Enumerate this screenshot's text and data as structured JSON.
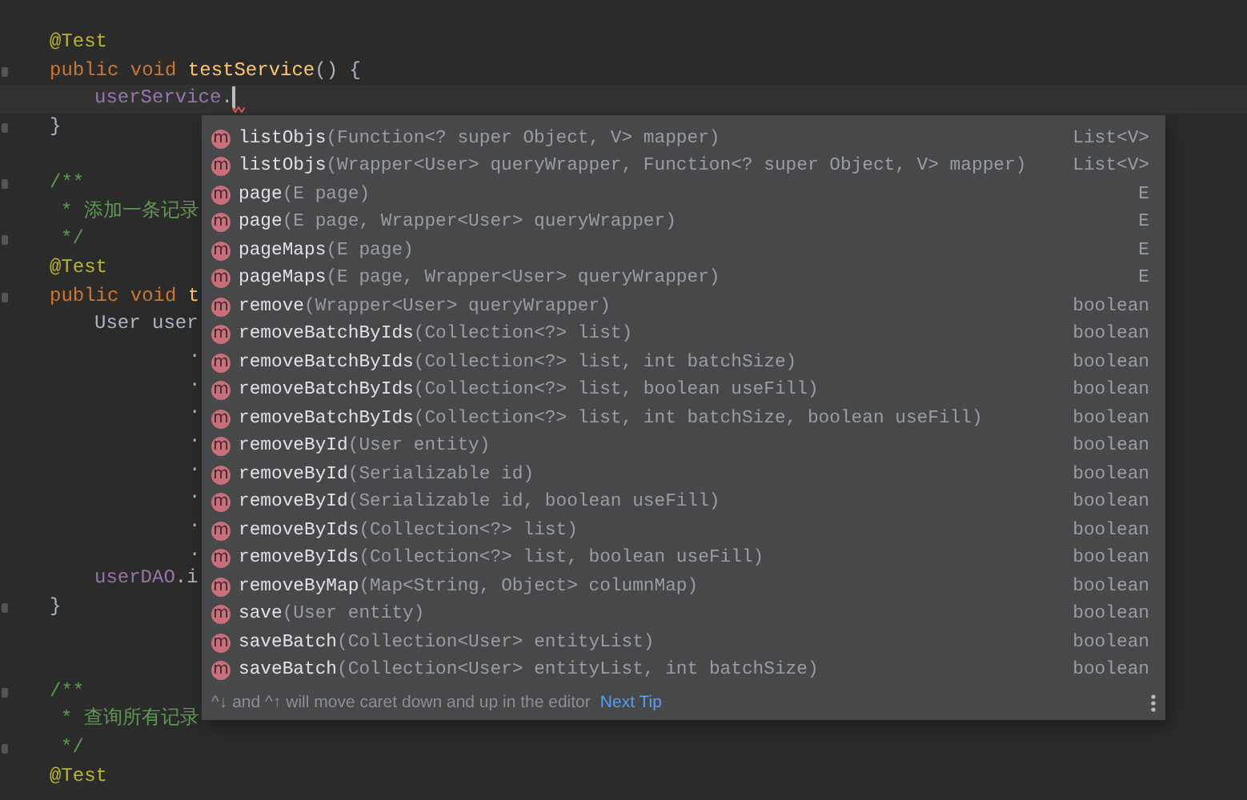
{
  "editor": {
    "lines": [
      {
        "kind": "top",
        "tokens": [
          {
            "text": "@Test",
            "kind": "annotation"
          }
        ]
      },
      {
        "kind": "top",
        "fold": true,
        "tokens": [
          {
            "text": "public void ",
            "kind": "keyword"
          },
          {
            "text": "testService",
            "kind": "method"
          },
          {
            "text": "() {",
            "kind": "plain"
          }
        ]
      },
      {
        "kind": "block",
        "current": true,
        "error_mark": true,
        "tokens": [
          {
            "text": "userService",
            "kind": "field"
          },
          {
            "text": ".",
            "kind": "plain"
          }
        ]
      },
      {
        "kind": "top",
        "fold": true,
        "tokens": [
          {
            "text": "}",
            "kind": "plain"
          }
        ]
      },
      {
        "kind": "blank"
      },
      {
        "kind": "top",
        "fold": true,
        "tokens": [
          {
            "text": "/**",
            "kind": "comment"
          }
        ]
      },
      {
        "kind": "doc",
        "tokens": [
          {
            "text": "* 添加一条记录",
            "kind": "comment"
          }
        ]
      },
      {
        "kind": "doc",
        "fold": true,
        "tokens": [
          {
            "text": "*/",
            "kind": "comment"
          }
        ]
      },
      {
        "kind": "top",
        "tokens": [
          {
            "text": "@Test",
            "kind": "annotation"
          }
        ]
      },
      {
        "kind": "top",
        "fold": true,
        "tokens": [
          {
            "text": "public void ",
            "kind": "keyword"
          },
          {
            "text": "t",
            "kind": "method"
          }
        ]
      },
      {
        "kind": "block",
        "tokens": [
          {
            "text": "User user",
            "kind": "plain"
          }
        ]
      },
      {
        "kind": "chain",
        "tokens": [
          {
            "text": ".",
            "kind": "plain"
          }
        ]
      },
      {
        "kind": "chain",
        "tokens": [
          {
            "text": ".",
            "kind": "plain"
          }
        ]
      },
      {
        "kind": "chain",
        "tokens": [
          {
            "text": ".",
            "kind": "plain"
          }
        ]
      },
      {
        "kind": "chain",
        "tokens": [
          {
            "text": ".",
            "kind": "plain"
          }
        ]
      },
      {
        "kind": "chain",
        "tokens": [
          {
            "text": ".",
            "kind": "plain"
          }
        ]
      },
      {
        "kind": "chain",
        "tokens": [
          {
            "text": ".",
            "kind": "plain"
          }
        ]
      },
      {
        "kind": "chain",
        "tokens": [
          {
            "text": ".",
            "kind": "plain"
          }
        ]
      },
      {
        "kind": "chain",
        "tokens": [
          {
            "text": ".",
            "kind": "plain"
          }
        ]
      },
      {
        "kind": "block",
        "tokens": [
          {
            "text": "userDAO",
            "kind": "field"
          },
          {
            "text": ".i",
            "kind": "plain"
          }
        ]
      },
      {
        "kind": "top",
        "fold": true,
        "tokens": [
          {
            "text": "}",
            "kind": "plain"
          }
        ]
      },
      {
        "kind": "blank"
      },
      {
        "kind": "blank"
      },
      {
        "kind": "top",
        "fold": true,
        "tokens": [
          {
            "text": "/**",
            "kind": "comment"
          }
        ]
      },
      {
        "kind": "doc",
        "tokens": [
          {
            "text": "* 查询所有记录",
            "kind": "comment"
          }
        ]
      },
      {
        "kind": "doc",
        "fold": true,
        "tokens": [
          {
            "text": "*/",
            "kind": "comment"
          }
        ]
      },
      {
        "kind": "top",
        "tokens": [
          {
            "text": "@Test",
            "kind": "annotation"
          }
        ]
      }
    ]
  },
  "completion_popup": {
    "items": [
      {
        "icon": "m",
        "name": "listObjs",
        "params": "(Function<? super Object, V> mapper)",
        "type": "List<V>",
        "selected": false
      },
      {
        "icon": "m",
        "name": "listObjs",
        "params": "(Wrapper<User> queryWrapper, Function<? super Object, V> mapper)",
        "type": "List<V>",
        "selected": false
      },
      {
        "icon": "m",
        "name": "page",
        "params": "(E page)",
        "type": "E",
        "selected": false
      },
      {
        "icon": "m",
        "name": "page",
        "params": "(E page, Wrapper<User> queryWrapper)",
        "type": "E",
        "selected": false
      },
      {
        "icon": "m",
        "name": "pageMaps",
        "params": "(E page)",
        "type": "E",
        "selected": false
      },
      {
        "icon": "m",
        "name": "pageMaps",
        "params": "(E page, Wrapper<User> queryWrapper)",
        "type": "E",
        "selected": false
      },
      {
        "icon": "m",
        "name": "remove",
        "params": "(Wrapper<User> queryWrapper)",
        "type": "boolean",
        "selected": false
      },
      {
        "icon": "m",
        "name": "removeBatchByIds",
        "params": "(Collection<?> list)",
        "type": "boolean",
        "selected": false
      },
      {
        "icon": "m",
        "name": "removeBatchByIds",
        "params": "(Collection<?> list, int batchSize)",
        "type": "boolean",
        "selected": false
      },
      {
        "icon": "m",
        "name": "removeBatchByIds",
        "params": "(Collection<?> list, boolean useFill)",
        "type": "boolean",
        "selected": false
      },
      {
        "icon": "m",
        "name": "removeBatchByIds",
        "params": "(Collection<?> list, int batchSize, boolean useFill)",
        "type": "boolean",
        "selected": false
      },
      {
        "icon": "m",
        "name": "removeById",
        "params": "(User entity)",
        "type": "boolean",
        "selected": false
      },
      {
        "icon": "m",
        "name": "removeById",
        "params": "(Serializable id)",
        "type": "boolean",
        "selected": false
      },
      {
        "icon": "m",
        "name": "removeById",
        "params": "(Serializable id, boolean useFill)",
        "type": "boolean",
        "selected": false
      },
      {
        "icon": "m",
        "name": "removeByIds",
        "params": "(Collection<?> list)",
        "type": "boolean",
        "selected": false
      },
      {
        "icon": "m",
        "name": "removeByIds",
        "params": "(Collection<?> list, boolean useFill)",
        "type": "boolean",
        "selected": false
      },
      {
        "icon": "m",
        "name": "removeByMap",
        "params": "(Map<String, Object> columnMap)",
        "type": "boolean",
        "selected": false
      },
      {
        "icon": "m",
        "name": "save",
        "params": "(User entity)",
        "type": "boolean",
        "selected": false
      },
      {
        "icon": "m",
        "name": "saveBatch",
        "params": "(Collection<User> entityList)",
        "type": "boolean",
        "selected": false
      },
      {
        "icon": "m",
        "name": "saveBatch",
        "params": "(Collection<User> entityList, int batchSize)",
        "type": "boolean",
        "selected": false
      }
    ],
    "footer": {
      "hint": "^↓ and ^↑ will move caret down and up in the editor",
      "link": "Next Tip"
    }
  }
}
